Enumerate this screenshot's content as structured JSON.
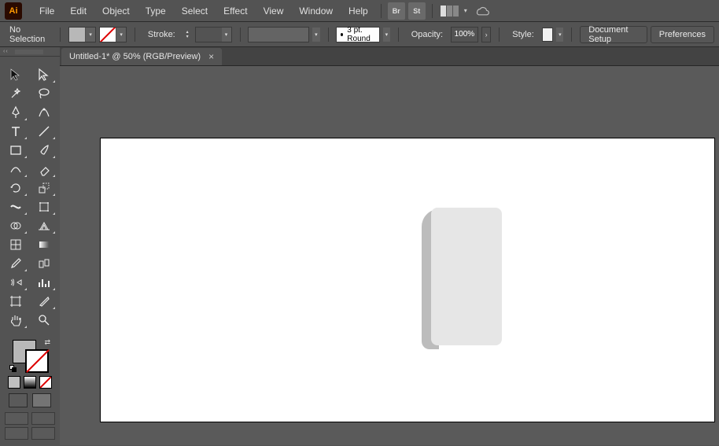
{
  "app": {
    "logo_text": "Ai"
  },
  "menu": {
    "file": "File",
    "edit": "Edit",
    "object": "Object",
    "type": "Type",
    "select": "Select",
    "effect": "Effect",
    "view": "View",
    "window": "Window",
    "help": "Help"
  },
  "extras": {
    "br": "Br",
    "st": "St"
  },
  "control": {
    "selection_status": "No Selection",
    "stroke_label": "Stroke:",
    "brush_preset": "3 pt. Round",
    "opacity_label": "Opacity:",
    "opacity_value": "100%",
    "style_label": "Style:",
    "doc_setup": "Document Setup",
    "preferences": "Preferences"
  },
  "tabs": {
    "doc1": "Untitled-1* @ 50% (RGB/Preview)",
    "close": "×"
  },
  "tools": {
    "selection": "selection",
    "direct_selection": "direct-selection",
    "magic_wand": "magic-wand",
    "lasso": "lasso",
    "pen": "pen",
    "curvature": "curvature",
    "type": "type",
    "line": "line",
    "rectangle": "rectangle",
    "paintbrush": "paintbrush",
    "shaper": "shaper",
    "eraser": "eraser",
    "rotate": "rotate",
    "scale": "scale",
    "width": "width",
    "free_transform": "free-transform",
    "shape_builder": "shape-builder",
    "perspective": "perspective",
    "mesh": "mesh",
    "gradient": "gradient",
    "eyedropper": "eyedropper",
    "blend": "blend",
    "symbol_sprayer": "symbol-sprayer",
    "column_graph": "column-graph",
    "artboard": "artboard",
    "slice": "slice",
    "hand": "hand",
    "zoom": "zoom"
  }
}
